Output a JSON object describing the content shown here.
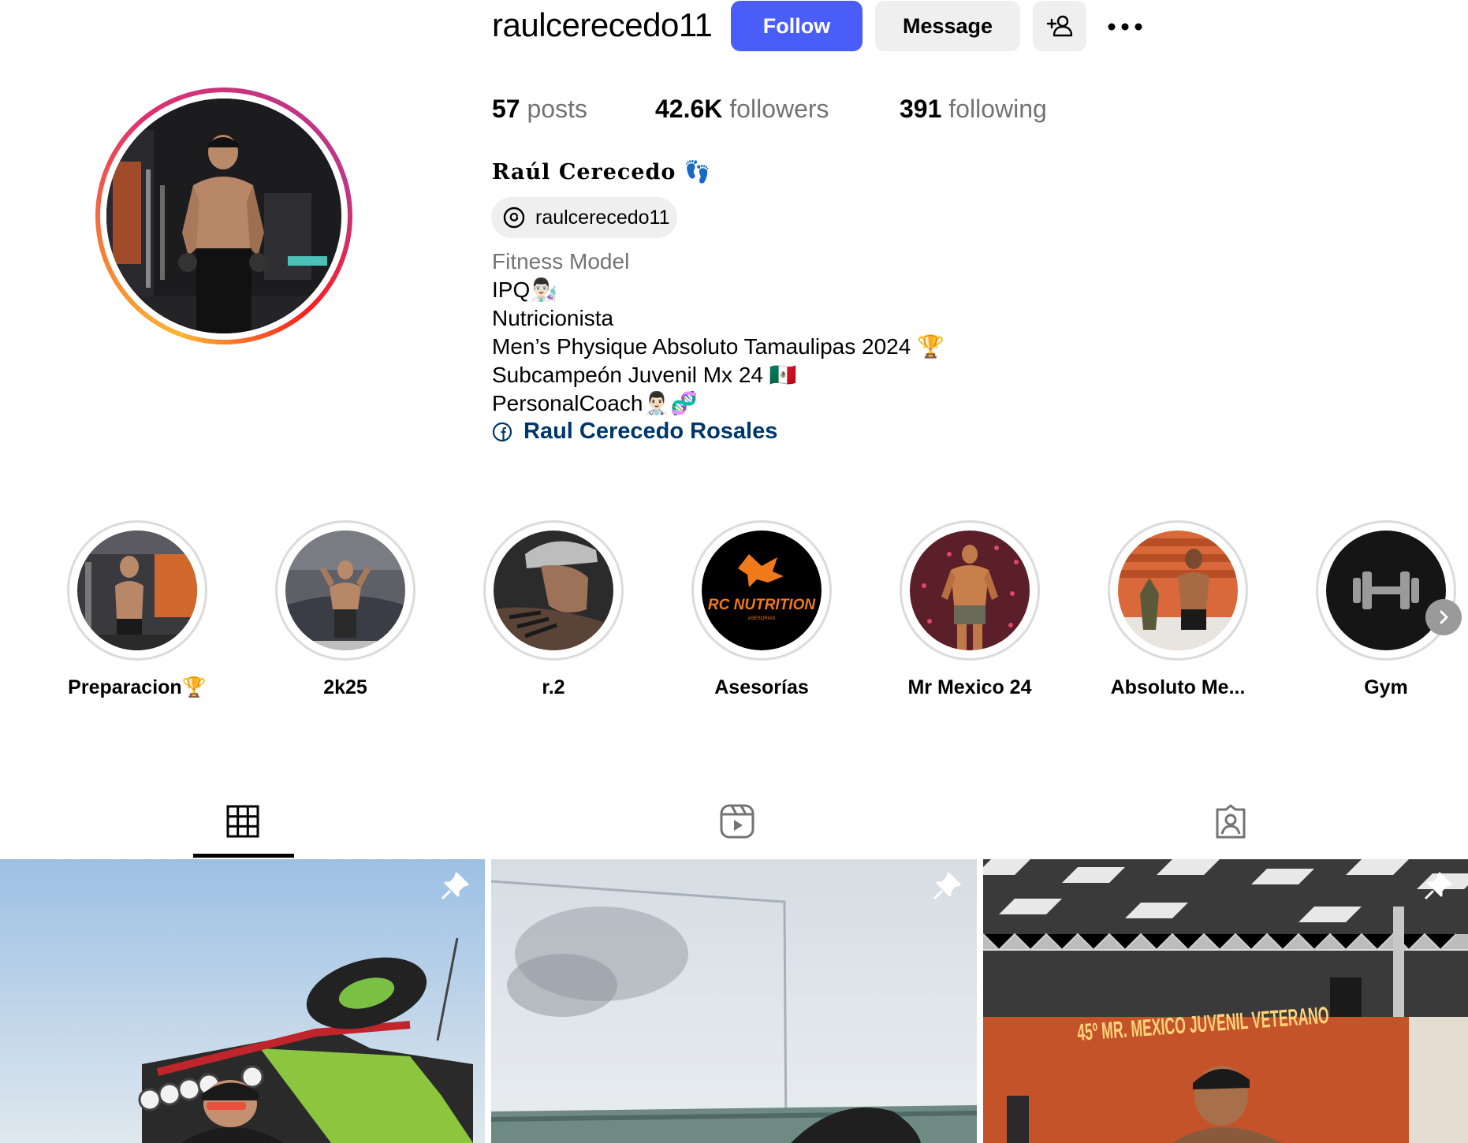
{
  "header": {
    "username": "raulcerecedo11",
    "follow_label": "Follow",
    "message_label": "Message"
  },
  "stats": {
    "posts_count": "57",
    "posts_label": "posts",
    "followers_count": "42.6K",
    "followers_label": "followers",
    "following_count": "391",
    "following_label": "following"
  },
  "profile": {
    "full_name": "Raúl Cerecedo 👣",
    "threads_handle": "raulcerecedo11",
    "category": "Fitness Model",
    "bio_lines": [
      "IPQ👨🏻‍🔬",
      "Nutricionista",
      "Men’s Physique Absoluto Tamaulipas 2024 🏆",
      "Subcampeón Juvenil Mx 24 🇲🇽",
      "PersonalCoach👨🏻‍⚕️🧬"
    ],
    "link_text": "Raul Cerecedo Rosales"
  },
  "highlights": [
    {
      "label": "Preparacion🏆"
    },
    {
      "label": "2k25"
    },
    {
      "label": "r.2"
    },
    {
      "label": "Asesorías",
      "logo_text": "RC NUTRITION",
      "logo_sub": "ASESORIAS"
    },
    {
      "label": "Mr Mexico 24"
    },
    {
      "label": "Absoluto Me..."
    },
    {
      "label": "Gym"
    }
  ],
  "tabs": [
    {
      "icon": "grid-icon",
      "active": true
    },
    {
      "icon": "reels-icon",
      "active": false
    },
    {
      "icon": "tagged-icon",
      "active": false
    }
  ],
  "posts": [
    {
      "pinned": true
    },
    {
      "pinned": true
    },
    {
      "pinned": true,
      "banner_text": "45º MR. MEXICO JUVENIL VETERANO"
    }
  ],
  "colors": {
    "follow_button": "#4a5df9",
    "secondary_button": "#efefef",
    "link": "#00376b",
    "muted_text": "#737373"
  }
}
